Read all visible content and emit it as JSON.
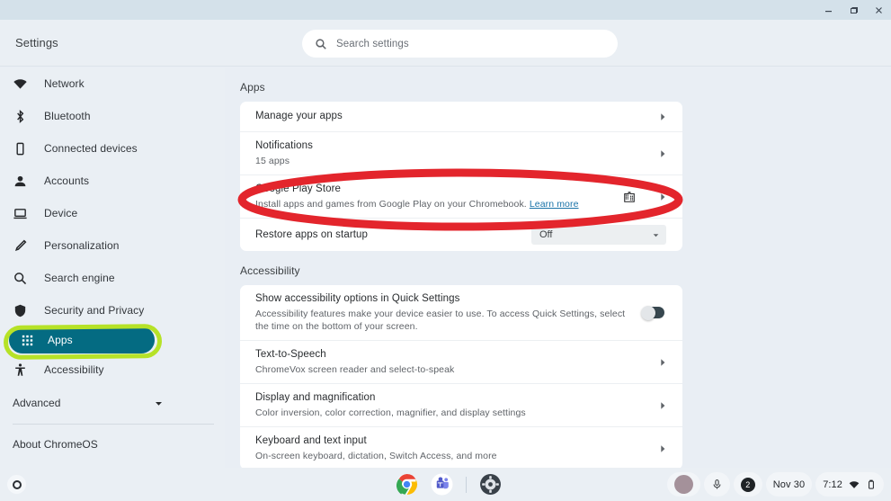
{
  "window": {
    "minimize_label": "Minimize",
    "maximize_label": "Maximize",
    "close_label": "Close"
  },
  "header": {
    "title": "Settings",
    "search_placeholder": "Search settings",
    "search_icon": "search-icon"
  },
  "sidebar": {
    "items": [
      {
        "label": "Network",
        "icon": "wifi-icon",
        "selected": false
      },
      {
        "label": "Bluetooth",
        "icon": "bluetooth-icon",
        "selected": false
      },
      {
        "label": "Connected devices",
        "icon": "phone-icon",
        "selected": false
      },
      {
        "label": "Accounts",
        "icon": "person-icon",
        "selected": false
      },
      {
        "label": "Device",
        "icon": "laptop-icon",
        "selected": false
      },
      {
        "label": "Personalization",
        "icon": "brush-icon",
        "selected": false
      },
      {
        "label": "Search engine",
        "icon": "search-icon",
        "selected": false
      },
      {
        "label": "Security and Privacy",
        "icon": "shield-icon",
        "selected": false
      },
      {
        "label": "Apps",
        "icon": "grid-apps-icon",
        "selected": true
      },
      {
        "label": "Accessibility",
        "icon": "accessibility-icon",
        "selected": false
      }
    ],
    "advanced_label": "Advanced",
    "advanced_icon": "chevron-down-icon",
    "about_label": "About ChromeOS",
    "selected_pill_color": "#046b82",
    "highlight_ring_color": "#b6e227"
  },
  "main": {
    "apps_section": {
      "label": "Apps",
      "rows": [
        {
          "title": "Manage your apps",
          "subtitle": "",
          "control": "chevron"
        },
        {
          "title": "Notifications",
          "subtitle": "15 apps",
          "control": "chevron"
        },
        {
          "title": "Google Play Store",
          "subtitle_before": "Install apps and games from Google Play on your Chromebook. ",
          "subtitle_link": "Learn more",
          "control": "chevron",
          "extra_icon": "play-store-grid-icon",
          "annotated": true
        },
        {
          "title": "Restore apps on startup",
          "subtitle": "",
          "control": "select",
          "select_value": "Off"
        }
      ]
    },
    "accessibility_section": {
      "label": "Accessibility",
      "rows": [
        {
          "title": "Show accessibility options in Quick Settings",
          "subtitle": "Accessibility features make your device easier to use. To access Quick Settings, select the time on the bottom of your screen.",
          "control": "toggle",
          "toggle_on": true
        },
        {
          "title": "Text-to-Speech",
          "subtitle": "ChromeVox screen reader and select-to-speak",
          "control": "chevron"
        },
        {
          "title": "Display and magnification",
          "subtitle": "Color inversion, color correction, magnifier, and display settings",
          "control": "chevron"
        },
        {
          "title": "Keyboard and text input",
          "subtitle": "On-screen keyboard, dictation, Switch Access, and more",
          "control": "chevron"
        }
      ]
    }
  },
  "annotations": {
    "red_ellipse_color": "#e3252c",
    "green_ring_color": "#b6e227"
  },
  "shelf": {
    "launcher_icon": "launcher-circle-icon",
    "apps": [
      {
        "name": "chrome-icon"
      },
      {
        "name": "microsoft-teams-icon"
      },
      {
        "name": "settings-gear-icon"
      }
    ],
    "tray": {
      "avatar_icon": "avatar",
      "mic_icon": "microphone-icon",
      "notification_count": "2",
      "date": "Nov 30",
      "time": "7:12",
      "wifi_icon": "wifi-icon",
      "battery_icon": "battery-icon"
    }
  }
}
